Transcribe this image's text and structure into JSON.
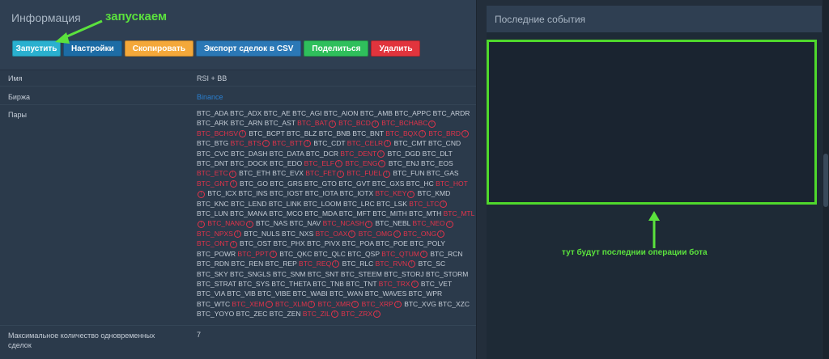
{
  "left": {
    "title": "Информация",
    "buttons": {
      "run": "Запустить",
      "settings": "Настройки",
      "copy": "Скопировать",
      "export": "Экспорт сделок в CSV",
      "share": "Поделиться",
      "delete": "Удалить"
    },
    "annotation_run": "запускаем",
    "rows": {
      "name_label": "Имя",
      "name_value": "RSI + BB",
      "exchange_label": "Биржа",
      "exchange_value": "Binance",
      "pairs_label": "Пары",
      "max_label_1": "Максимальное количество одновременных",
      "max_label_2": "сделок",
      "max_value": "7"
    },
    "pairs": [
      [
        "BTC_ADA",
        false
      ],
      [
        "BTC_ADX",
        false
      ],
      [
        "BTC_AE",
        false
      ],
      [
        "BTC_AGI",
        false
      ],
      [
        "BTC_AION",
        false
      ],
      [
        "BTC_AMB",
        false
      ],
      [
        "BTC_APPC",
        false
      ],
      [
        "BTC_ARDR",
        false
      ],
      [
        "BTC_ARK",
        false
      ],
      [
        "BTC_ARN",
        false
      ],
      [
        "BTC_AST",
        false
      ],
      [
        "BTC_BAT",
        true
      ],
      [
        "BTC_BCD",
        true
      ],
      [
        "BTC_BCHABC",
        true
      ],
      [
        "BTC_BCHSV",
        true
      ],
      [
        "BTC_BCPT",
        false
      ],
      [
        "BTC_BLZ",
        false
      ],
      [
        "BTC_BNB",
        false
      ],
      [
        "BTC_BNT",
        false
      ],
      [
        "BTC_BQX",
        true
      ],
      [
        "BTC_BRD",
        true
      ],
      [
        "BTC_BTG",
        false
      ],
      [
        "BTC_BTS",
        true
      ],
      [
        "BTC_BTT",
        true
      ],
      [
        "BTC_CDT",
        false
      ],
      [
        "BTC_CELR",
        true
      ],
      [
        "BTC_CMT",
        false
      ],
      [
        "BTC_CND",
        false
      ],
      [
        "BTC_CVC",
        false
      ],
      [
        "BTC_DASH",
        false
      ],
      [
        "BTC_DATA",
        false
      ],
      [
        "BTC_DCR",
        false
      ],
      [
        "BTC_DENT",
        true
      ],
      [
        "BTC_DGD",
        false
      ],
      [
        "BTC_DLT",
        false
      ],
      [
        "BTC_DNT",
        false
      ],
      [
        "BTC_DOCK",
        false
      ],
      [
        "BTC_EDO",
        false
      ],
      [
        "BTC_ELF",
        true
      ],
      [
        "BTC_ENG",
        true
      ],
      [
        "BTC_ENJ",
        false
      ],
      [
        "BTC_EOS",
        false
      ],
      [
        "BTC_ETC",
        true
      ],
      [
        "BTC_ETH",
        false
      ],
      [
        "BTC_EVX",
        false
      ],
      [
        "BTC_FET",
        true
      ],
      [
        "BTC_FUEL",
        true
      ],
      [
        "BTC_FUN",
        false
      ],
      [
        "BTC_GAS",
        false
      ],
      [
        "BTC_GNT",
        true
      ],
      [
        "BTC_GO",
        false
      ],
      [
        "BTC_GRS",
        false
      ],
      [
        "BTC_GTO",
        false
      ],
      [
        "BTC_GVT",
        false
      ],
      [
        "BTC_GXS",
        false
      ],
      [
        "BTC_HC",
        false
      ],
      [
        "BTC_HOT",
        true
      ],
      [
        "BTC_ICX",
        false
      ],
      [
        "BTC_INS",
        false
      ],
      [
        "BTC_IOST",
        false
      ],
      [
        "BTC_IOTA",
        false
      ],
      [
        "BTC_IOTX",
        false
      ],
      [
        "BTC_KEY",
        true
      ],
      [
        "BTC_KMD",
        false
      ],
      [
        "BTC_KNC",
        false
      ],
      [
        "BTC_LEND",
        false
      ],
      [
        "BTC_LINK",
        false
      ],
      [
        "BTC_LOOM",
        false
      ],
      [
        "BTC_LRC",
        false
      ],
      [
        "BTC_LSK",
        false
      ],
      [
        "BTC_LTC",
        true
      ],
      [
        "BTC_LUN",
        false
      ],
      [
        "BTC_MANA",
        false
      ],
      [
        "BTC_MCO",
        false
      ],
      [
        "BTC_MDA",
        false
      ],
      [
        "BTC_MFT",
        false
      ],
      [
        "BTC_MITH",
        false
      ],
      [
        "BTC_MTH",
        false
      ],
      [
        "BTC_MTL",
        true
      ],
      [
        "BTC_NANO",
        true
      ],
      [
        "BTC_NAS",
        false
      ],
      [
        "BTC_NAV",
        false
      ],
      [
        "BTC_NCASH",
        true
      ],
      [
        "BTC_NEBL",
        false
      ],
      [
        "BTC_NEO",
        true
      ],
      [
        "BTC_NPXS",
        true
      ],
      [
        "BTC_NULS",
        false
      ],
      [
        "BTC_NXS",
        false
      ],
      [
        "BTC_OAX",
        true
      ],
      [
        "BTC_OMG",
        true
      ],
      [
        "BTC_ONG",
        true
      ],
      [
        "BTC_ONT",
        true
      ],
      [
        "BTC_OST",
        false
      ],
      [
        "BTC_PHX",
        false
      ],
      [
        "BTC_PIVX",
        false
      ],
      [
        "BTC_POA",
        false
      ],
      [
        "BTC_POE",
        false
      ],
      [
        "BTC_POLY",
        false
      ],
      [
        "BTC_POWR",
        false
      ],
      [
        "BTC_PPT",
        true
      ],
      [
        "BTC_QKC",
        false
      ],
      [
        "BTC_QLC",
        false
      ],
      [
        "BTC_QSP",
        false
      ],
      [
        "BTC_QTUM",
        true
      ],
      [
        "BTC_RCN",
        false
      ],
      [
        "BTC_RDN",
        false
      ],
      [
        "BTC_REN",
        false
      ],
      [
        "BTC_REP",
        false
      ],
      [
        "BTC_REQ",
        true
      ],
      [
        "BTC_RLC",
        false
      ],
      [
        "BTC_RVN",
        true
      ],
      [
        "BTC_SC",
        false
      ],
      [
        "BTC_SKY",
        false
      ],
      [
        "BTC_SNGLS",
        false
      ],
      [
        "BTC_SNM",
        false
      ],
      [
        "BTC_SNT",
        false
      ],
      [
        "BTC_STEEM",
        false
      ],
      [
        "BTC_STORJ",
        false
      ],
      [
        "BTC_STORM",
        false
      ],
      [
        "BTC_STRAT",
        false
      ],
      [
        "BTC_SYS",
        false
      ],
      [
        "BTC_THETA",
        false
      ],
      [
        "BTC_TNB",
        false
      ],
      [
        "BTC_TNT",
        false
      ],
      [
        "BTC_TRX",
        true
      ],
      [
        "BTC_VET",
        false
      ],
      [
        "BTC_VIA",
        false
      ],
      [
        "BTC_VIB",
        false
      ],
      [
        "BTC_VIBE",
        false
      ],
      [
        "BTC_WABI",
        false
      ],
      [
        "BTC_WAN",
        false
      ],
      [
        "BTC_WAVES",
        false
      ],
      [
        "BTC_WPR",
        false
      ],
      [
        "BTC_WTC",
        false
      ],
      [
        "BTC_XEM",
        true
      ],
      [
        "BTC_XLM",
        true
      ],
      [
        "BTC_XMR",
        true
      ],
      [
        "BTC_XRP",
        true
      ],
      [
        "BTC_XVG",
        false
      ],
      [
        "BTC_XZC",
        false
      ],
      [
        "BTC_YOYO",
        false
      ],
      [
        "BTC_ZEC",
        false
      ],
      [
        "BTC_ZEN",
        false
      ],
      [
        "BTC_ZIL",
        true
      ],
      [
        "BTC_ZRX",
        true
      ]
    ]
  },
  "right": {
    "title": "Последние события",
    "annotation": "тут будут последнии операции бота"
  },
  "colors": {
    "accent_green": "#5be23d",
    "pair_warning": "#e1334a"
  },
  "icons": {
    "warning": "warning-circle-icon"
  }
}
